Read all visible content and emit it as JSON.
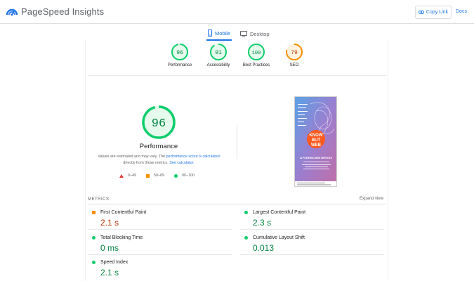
{
  "header": {
    "app_name": "PageSpeed Insights",
    "copy_link_label": "Copy Link",
    "docs_label": "Docs"
  },
  "tabs": [
    {
      "label": "Mobile",
      "active": true,
      "icon": "smartphone-icon"
    },
    {
      "label": "Desktop",
      "active": false,
      "icon": "desktop-icon"
    }
  ],
  "category_scores": [
    {
      "label": "Performance",
      "score": "96",
      "status": "pass"
    },
    {
      "label": "Accessibility",
      "score": "91",
      "status": "pass"
    },
    {
      "label": "Best Practices",
      "score": "100",
      "status": "pass"
    },
    {
      "label": "SEO",
      "score": "79",
      "status": "average"
    }
  ],
  "performance": {
    "score": "96",
    "title": "Performance",
    "note_prefix": "Values are estimated and may vary. The ",
    "note_link1": "performance score is calculated",
    "note_middle": " directly from these metrics. ",
    "note_link2": "See calculator."
  },
  "legend": [
    {
      "range": "0–49",
      "shape": "triangle",
      "color": "#e53935"
    },
    {
      "range": "50–89",
      "shape": "square",
      "color": "#fb8c00"
    },
    {
      "range": "90–100",
      "shape": "circle",
      "color": "#0cce6b"
    }
  ],
  "screenshot": {
    "heading_lines": [
      "KNOW",
      "BUT",
      "WEB"
    ],
    "tagline": "AI POWERED WEB SERVICES"
  },
  "metrics": {
    "section_title": "METRICS",
    "expand_label": "Expand view",
    "items": [
      {
        "label": "First Contentful Paint",
        "value": "2.1 s",
        "status": "average"
      },
      {
        "label": "Largest Contentful Paint",
        "value": "2.3 s",
        "status": "pass"
      },
      {
        "label": "Total Blocking Time",
        "value": "0 ms",
        "status": "pass"
      },
      {
        "label": "Cumulative Layout Shift",
        "value": "0.013",
        "status": "pass"
      },
      {
        "label": "Speed Index",
        "value": "2.1 s",
        "status": "pass"
      }
    ]
  },
  "colors": {
    "accent": "#1a73e8",
    "pass": "#0cce6b",
    "pass_text": "#018642",
    "average": "#fb8c00",
    "average_text": "#c33300",
    "fail": "#e53935"
  }
}
